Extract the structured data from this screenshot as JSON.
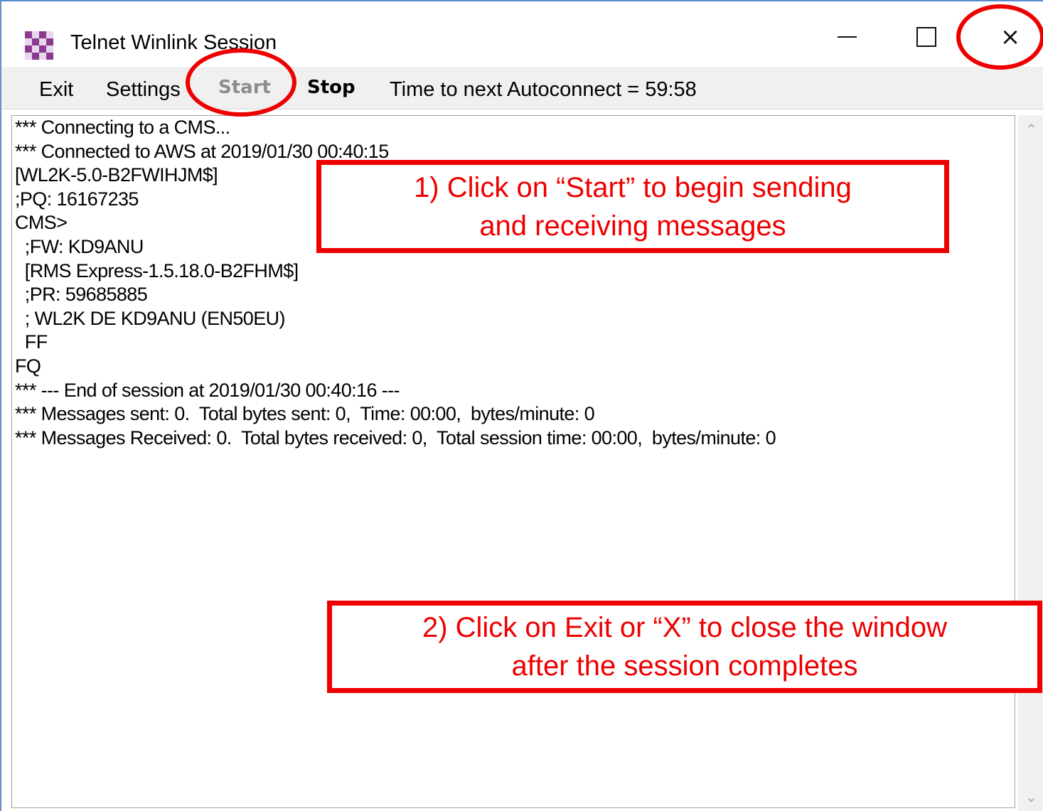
{
  "window": {
    "title": "Telnet Winlink Session",
    "controls": {
      "minimize": "minimize",
      "maximize": "maximize",
      "close": "×"
    }
  },
  "menu": {
    "exit": "Exit",
    "settings": "Settings",
    "start": "Start",
    "stop": "Stop",
    "autoconnect": "Time to next Autoconnect = 59:58"
  },
  "log": [
    "*** Connecting to a CMS...",
    "*** Connected to AWS at 2019/01/30 00:40:15",
    "[WL2K-5.0-B2FWIHJM$]",
    ";PQ: 16167235",
    "CMS>",
    "  ;FW: KD9ANU",
    "  [RMS Express-1.5.18.0-B2FHM$]",
    "  ;PR: 59685885",
    "  ; WL2K DE KD9ANU (EN50EU)",
    "  FF",
    "FQ",
    "*** --- End of session at 2019/01/30 00:40:16 ---",
    "*** Messages sent: 0.  Total bytes sent: 0,  Time: 00:00,  bytes/minute: 0",
    "*** Messages Received: 0.  Total bytes received: 0,  Total session time: 00:00,  bytes/minute: 0"
  ],
  "annotations": {
    "step1_line1": "1) Click on “Start” to begin sending",
    "step1_line2": "and receiving messages",
    "step2_line1": "2) Click on Exit or “X” to close the window",
    "step2_line2": "after the session completes"
  },
  "colors": {
    "annotation_red": "#ee0000",
    "disabled_gray": "#8d8d8d",
    "menu_bg": "#f0f0f0",
    "app_icon_purple": "#8a3a8f"
  },
  "icons": {
    "app": "telnet-winlink-app-icon",
    "scroll_up": "chevron-up-icon",
    "scroll_down": "chevron-down-icon"
  }
}
